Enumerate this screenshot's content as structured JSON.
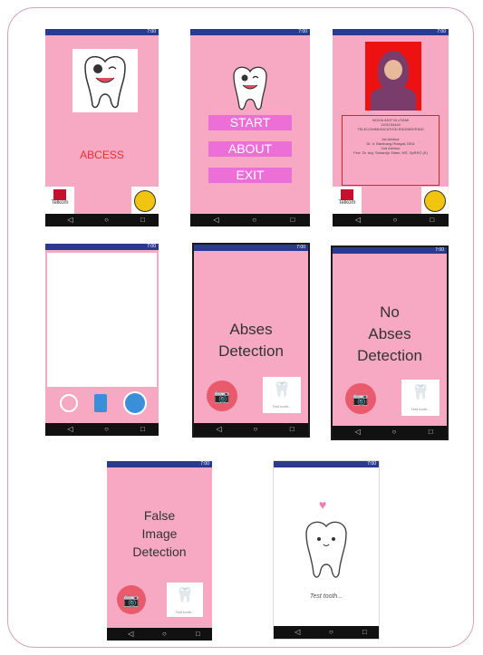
{
  "status_time": "7:00",
  "nav_icons": {
    "back": "◁",
    "home": "○",
    "recent": "□"
  },
  "colors": {
    "pink": "#f7a8c2",
    "status_bar": "#2a3b8f",
    "menu_button": "#ec6fd8",
    "camera": "#e95a6d",
    "abcess_text": "#e83030"
  },
  "screen1": {
    "title": "ABCESS",
    "logo_left_text": "Telkom",
    "logo_right_icon": "university-seal-icon"
  },
  "screen2": {
    "buttons": [
      "START",
      "ABOUT",
      "EXIT"
    ]
  },
  "screen3": {
    "name": "NOVIA ADITYA UTAMI",
    "id": "1101154440",
    "dept": "TELECOMMUNICATION ENGINEERING",
    "lines": [
      "1st Advisor",
      "Dr. Ir. Bambang Hidayat, DEA",
      "2nd Advisor",
      "Prof. Dr. drg. Suhardjo Sitam, MS, SpRKG (K)"
    ],
    "logo_left_text": "Telkom"
  },
  "screen5": {
    "line1": "Abses",
    "line2": "Detection"
  },
  "screen6": {
    "line1": "No",
    "line2": "Abses",
    "line3": "Detection"
  },
  "screen7": {
    "line1": "False",
    "line2": "Image",
    "line3": "Detection"
  },
  "screen8": {
    "caption": "Test tooth..."
  },
  "thumb_caption": "Test tooth..."
}
